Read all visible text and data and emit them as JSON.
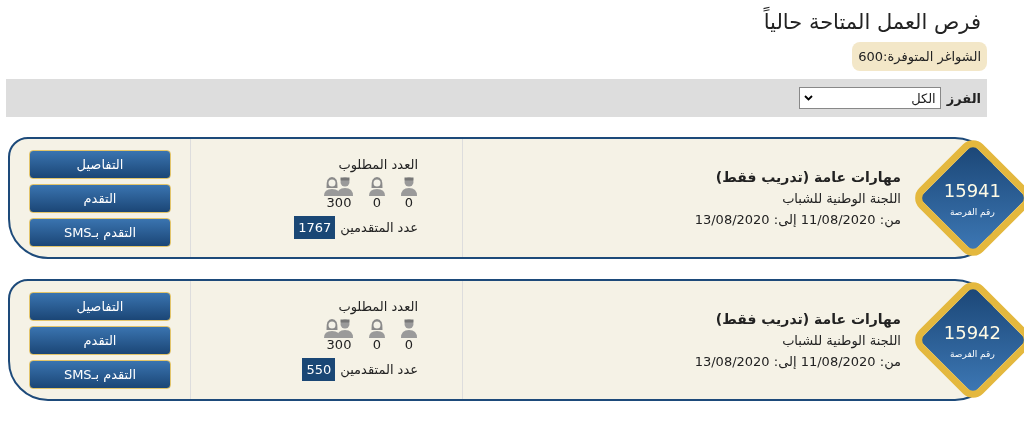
{
  "page_title": "فرص العمل المتاحة حالياً",
  "vacancies_badge": "الشواغر المتوفرة:600",
  "filter": {
    "label": "الفرز",
    "value": "الكل"
  },
  "opportunities": [
    {
      "number": "15941",
      "number_label": "رقم الفرصة",
      "title": "مهارات عامة (تدريب فقط)",
      "organization": "اللجنة الوطنية للشباب",
      "dates": "من: 11/08/2020 إلى: 13/08/2020",
      "required_label": "العدد المطلوب",
      "required": [
        {
          "kind": "male",
          "count": "0"
        },
        {
          "kind": "female",
          "count": "0"
        },
        {
          "kind": "any",
          "count": "300"
        }
      ],
      "applicants_label": "عدد المتقدمين",
      "applicants": "1767",
      "buttons": [
        "التفاصيل",
        "التقدم",
        "التقدم بـSMS"
      ]
    },
    {
      "number": "15942",
      "number_label": "رقم الفرصة",
      "title": "مهارات عامة (تدريب فقط)",
      "organization": "اللجنة الوطنية للشباب",
      "dates": "من: 11/08/2020 إلى: 13/08/2020",
      "required_label": "العدد المطلوب",
      "required": [
        {
          "kind": "male",
          "count": "0"
        },
        {
          "kind": "female",
          "count": "0"
        },
        {
          "kind": "any",
          "count": "300"
        }
      ],
      "applicants_label": "عدد المتقدمين",
      "applicants": "550",
      "buttons": [
        "التفاصيل",
        "التقدم",
        "التقدم بـSMS"
      ]
    }
  ]
}
